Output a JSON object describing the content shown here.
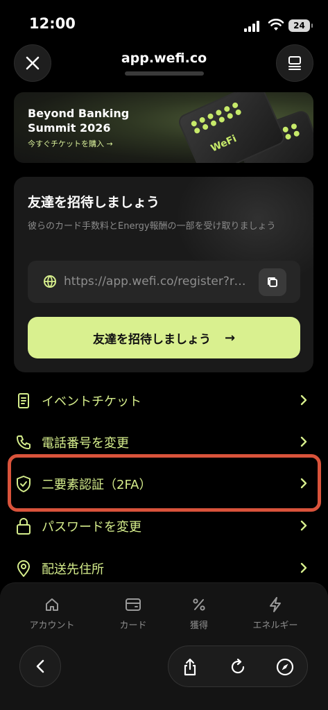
{
  "status": {
    "time": "12:00",
    "battery": "24"
  },
  "header": {
    "url": "app.wefi.co"
  },
  "banner": {
    "title": "Beyond Banking\nSummit 2026",
    "link": "今すぐチケットを購入 →",
    "ticket_logo": "WeFi"
  },
  "invite": {
    "title": "友達を招待しましょう",
    "description": "彼らのカード手数料とEnergy報酬の一部を受け取りましょう",
    "link": "https://app.wefi.co/register?ref=",
    "button_label": "友達を招待しましょう",
    "button_arrow": "→"
  },
  "menu": {
    "items": [
      {
        "label": "イベントチケット",
        "icon": "receipt-icon"
      },
      {
        "label": "電話番号を変更",
        "icon": "phone-icon"
      },
      {
        "label": "二要素認証（2FA）",
        "icon": "shield-check-icon"
      },
      {
        "label": "パスワードを変更",
        "icon": "lock-icon"
      },
      {
        "label": "配送先住所",
        "icon": "map-pin-icon"
      }
    ]
  },
  "tabs": [
    {
      "label": "アカウント",
      "icon": "home-icon"
    },
    {
      "label": "カード",
      "icon": "card-icon"
    },
    {
      "label": "獲得",
      "icon": "percent-icon"
    },
    {
      "label": "エネルギー",
      "icon": "bolt-icon"
    }
  ],
  "colors": {
    "accent": "#d9f08f",
    "menu_text": "#d6ee8c",
    "highlight": "#d9533b"
  }
}
